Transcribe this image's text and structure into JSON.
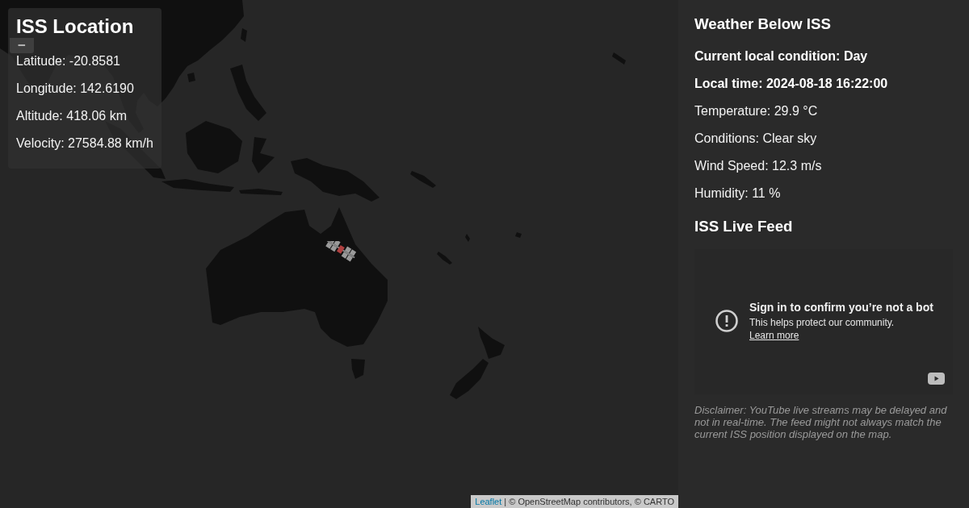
{
  "map": {
    "zoom_buttons": [
      {
        "label": "−"
      }
    ],
    "attribution": {
      "link": "Leaflet",
      "text": "| © OpenStreetMap contributors, © CARTO"
    }
  },
  "iss_location": {
    "title": "ISS Location",
    "lines": [
      "Latitude: -20.8581",
      "Longitude: 142.6190",
      "Altitude: 418.06 km",
      "Velocity: 27584.88 km/h"
    ]
  },
  "weather": {
    "title": "Weather Below ISS",
    "lines": [
      {
        "kind": "emphasis",
        "text": "Current local condition: Day"
      },
      {
        "kind": "emphasis",
        "text": "Local time: 2024-08-18 16:22:00"
      },
      {
        "kind": "plain",
        "text": "Temperature: 29.9 °C"
      },
      {
        "kind": "plain",
        "text": "Conditions: Clear sky"
      },
      {
        "kind": "plain",
        "text": "Wind Speed: 12.3 m/s"
      },
      {
        "kind": "plain",
        "text": "Humidity: 11 %"
      }
    ]
  },
  "live_feed": {
    "title": "ISS Live Feed",
    "video": {
      "heading": "Sign in to confirm you’re not a bot",
      "message": "This helps protect our community.",
      "link": "Learn more"
    },
    "disclaimer": "Disclaimer: YouTube live streams may be delayed and not in real-time. The feed might not always match the current ISS position displayed on the map."
  }
}
